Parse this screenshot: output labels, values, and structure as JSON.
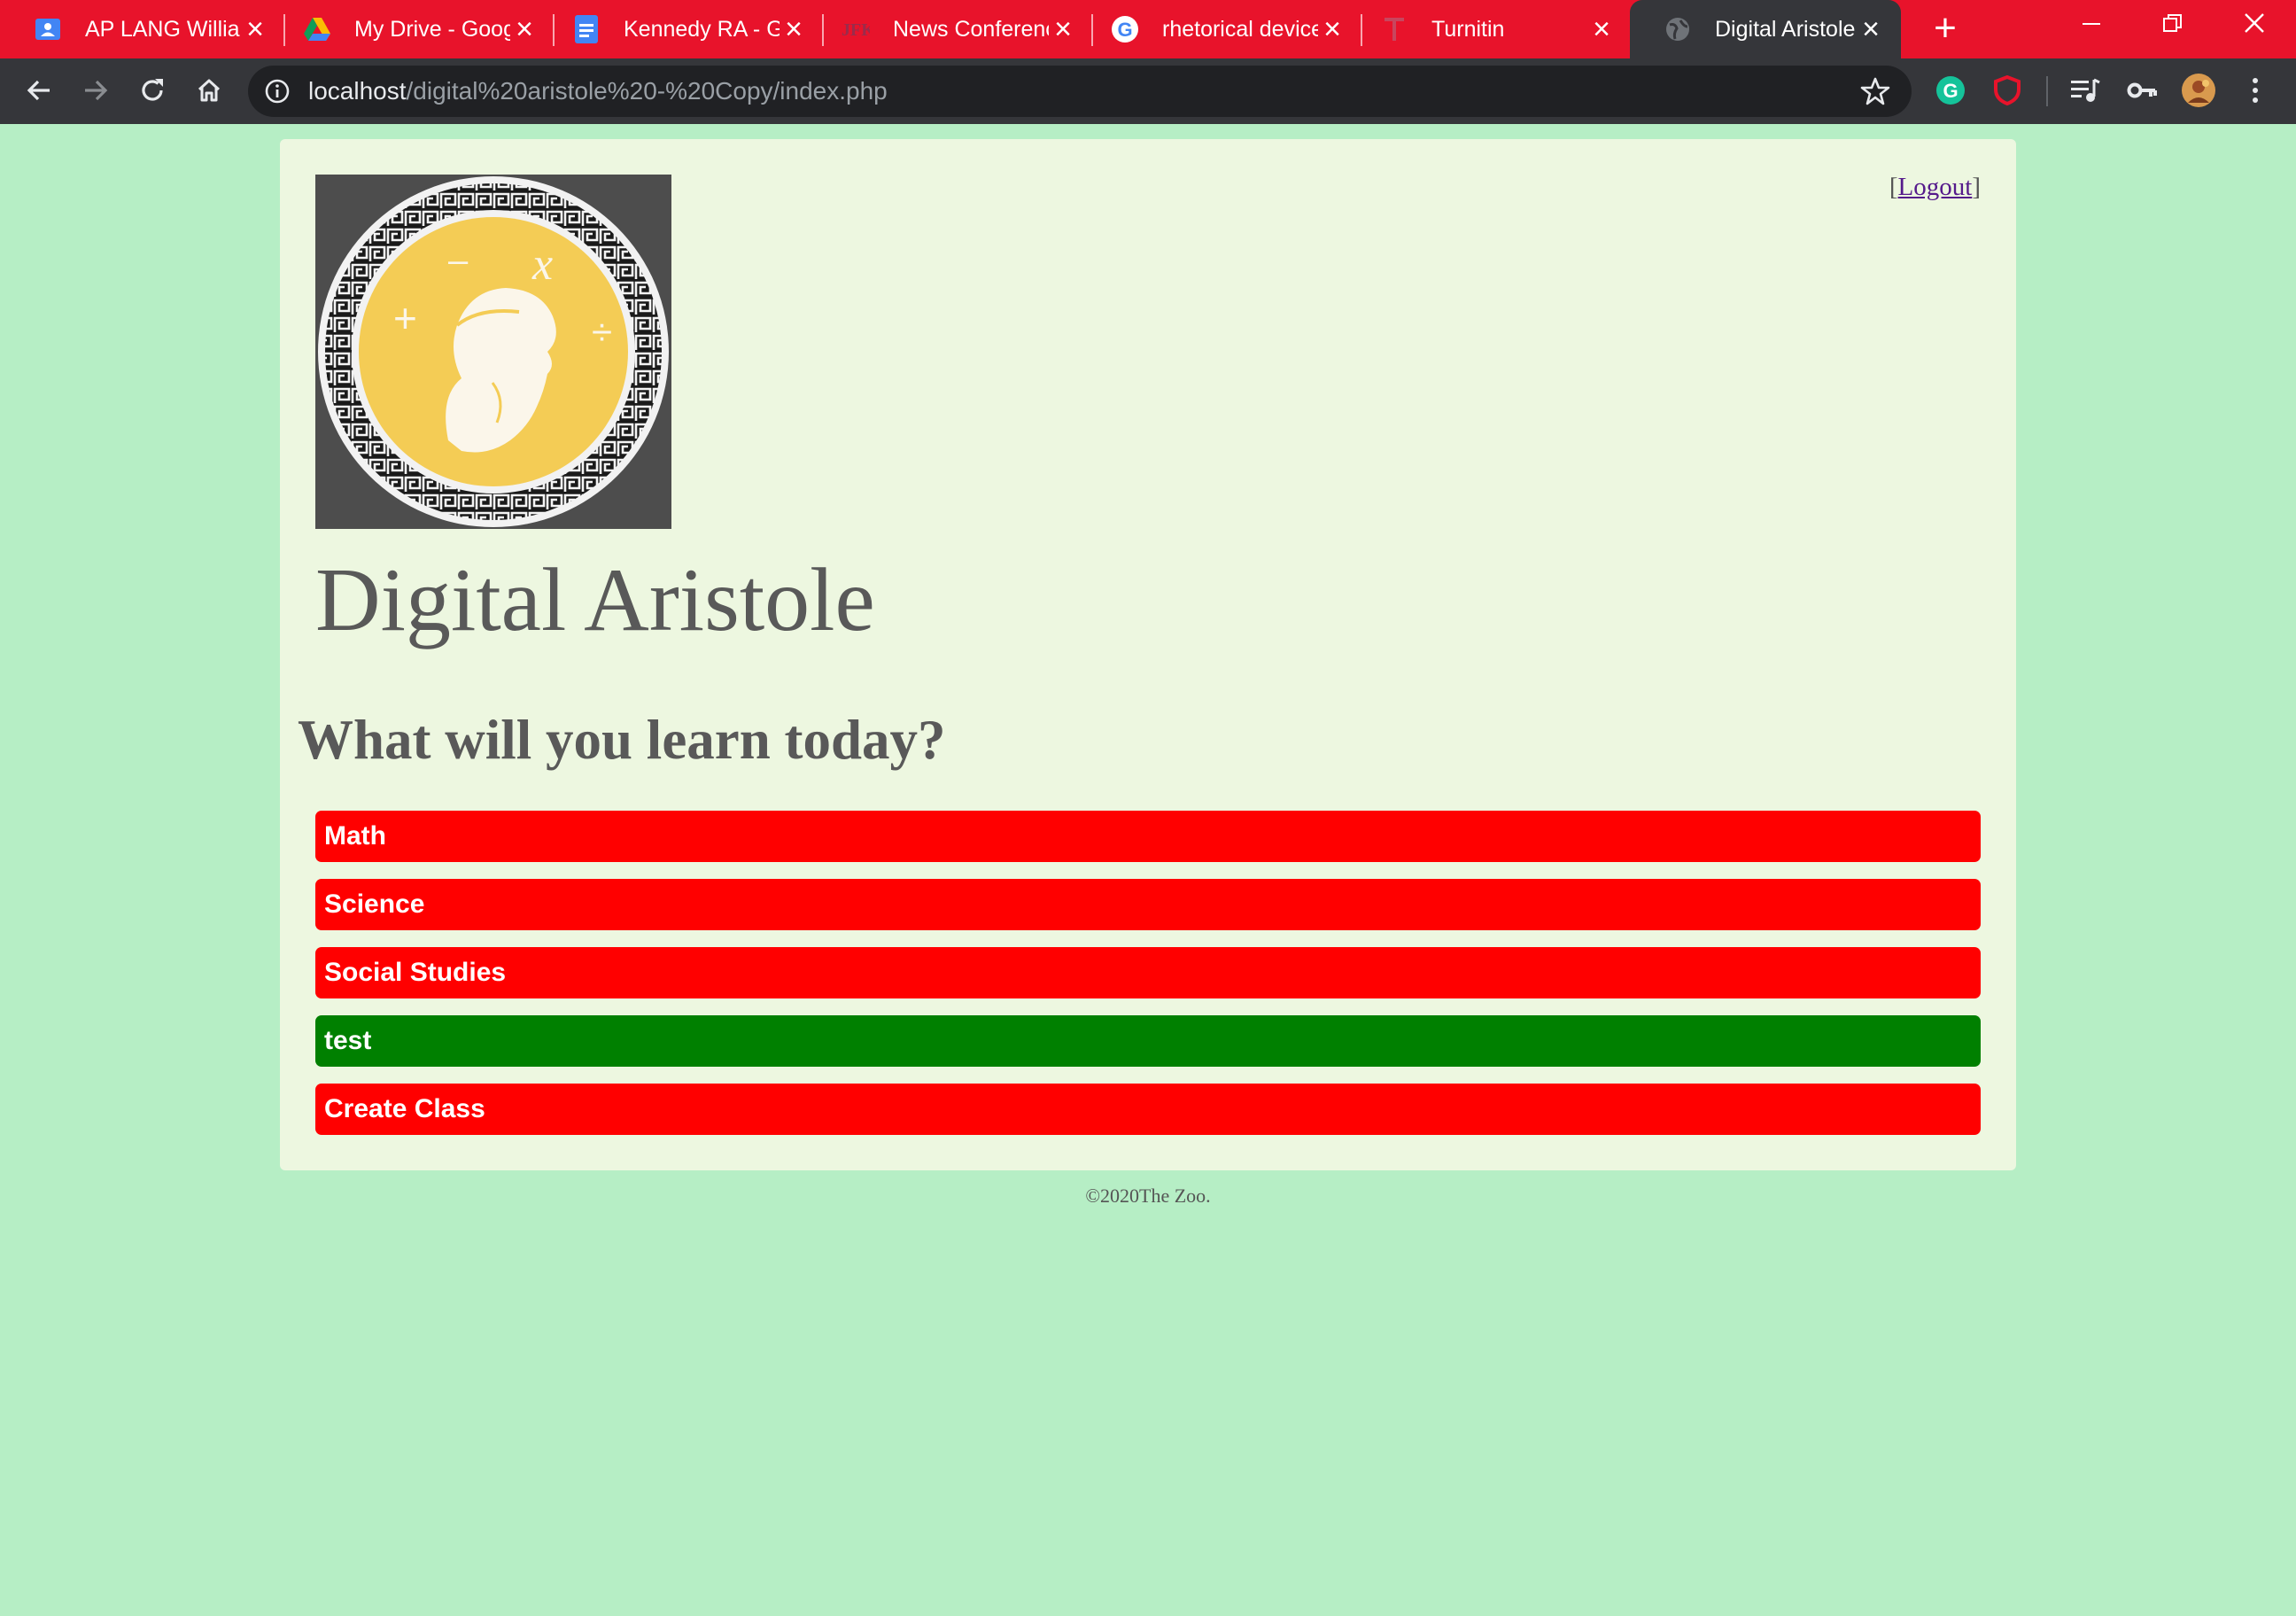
{
  "browser": {
    "tabs": [
      {
        "title": "AP LANG William",
        "icon": "classroom-icon",
        "active": false
      },
      {
        "title": "My Drive - Goog",
        "icon": "google-drive-icon",
        "active": false
      },
      {
        "title": "Kennedy RA - Go",
        "icon": "google-docs-icon",
        "active": false
      },
      {
        "title": "News Conference",
        "icon": "jfk-library-icon",
        "active": false
      },
      {
        "title": "rhetorical device",
        "icon": "google-icon",
        "active": false
      },
      {
        "title": "Turnitin",
        "icon": "turnitin-icon",
        "active": false
      },
      {
        "title": "Digital Aristole",
        "icon": "globe-icon",
        "active": true
      }
    ],
    "address_bar": {
      "host": "localhost",
      "path": "/digital%20aristole%20-%20Copy/index.php"
    },
    "colors": {
      "tab_strip": "#e8132b",
      "toolbar": "#35363a",
      "omnibox": "#202124"
    }
  },
  "page": {
    "logout": {
      "bracket_open": "[",
      "label": "Logout",
      "bracket_close": "]"
    },
    "title": "Digital Aristole",
    "heading": "What will you learn today?",
    "classes": [
      {
        "label": "Math",
        "color": "#ff0000"
      },
      {
        "label": "Science",
        "color": "#ff0000"
      },
      {
        "label": "Social Studies",
        "color": "#ff0000"
      },
      {
        "label": "test",
        "color": "#008000"
      },
      {
        "label": "Create Class",
        "color": "#ff0000"
      }
    ],
    "footer": "©2020The Zoo.",
    "colors": {
      "background": "#b6eec5",
      "card": "#edf7e0",
      "text": "#595959"
    }
  }
}
